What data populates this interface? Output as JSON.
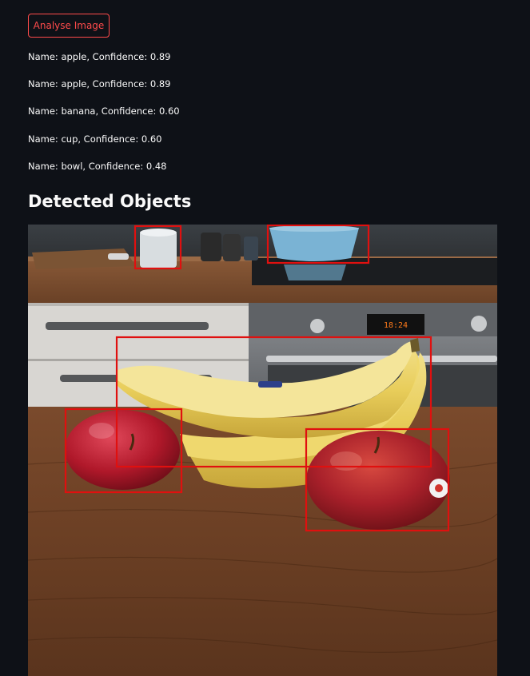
{
  "toolbar": {
    "analyse_label": "Analyse Image"
  },
  "results": [
    "Name: apple, Confidence: 0.89",
    "Name: apple, Confidence: 0.89",
    "Name: banana, Confidence: 0.60",
    "Name: cup, Confidence: 0.60",
    "Name: bowl, Confidence: 0.48"
  ],
  "section": {
    "title": "Detected Objects"
  },
  "photo": {
    "oven_display": "18:24"
  },
  "colors": {
    "background": "#0e1117",
    "accent": "#ff4b4b",
    "box": "#e0100f"
  }
}
